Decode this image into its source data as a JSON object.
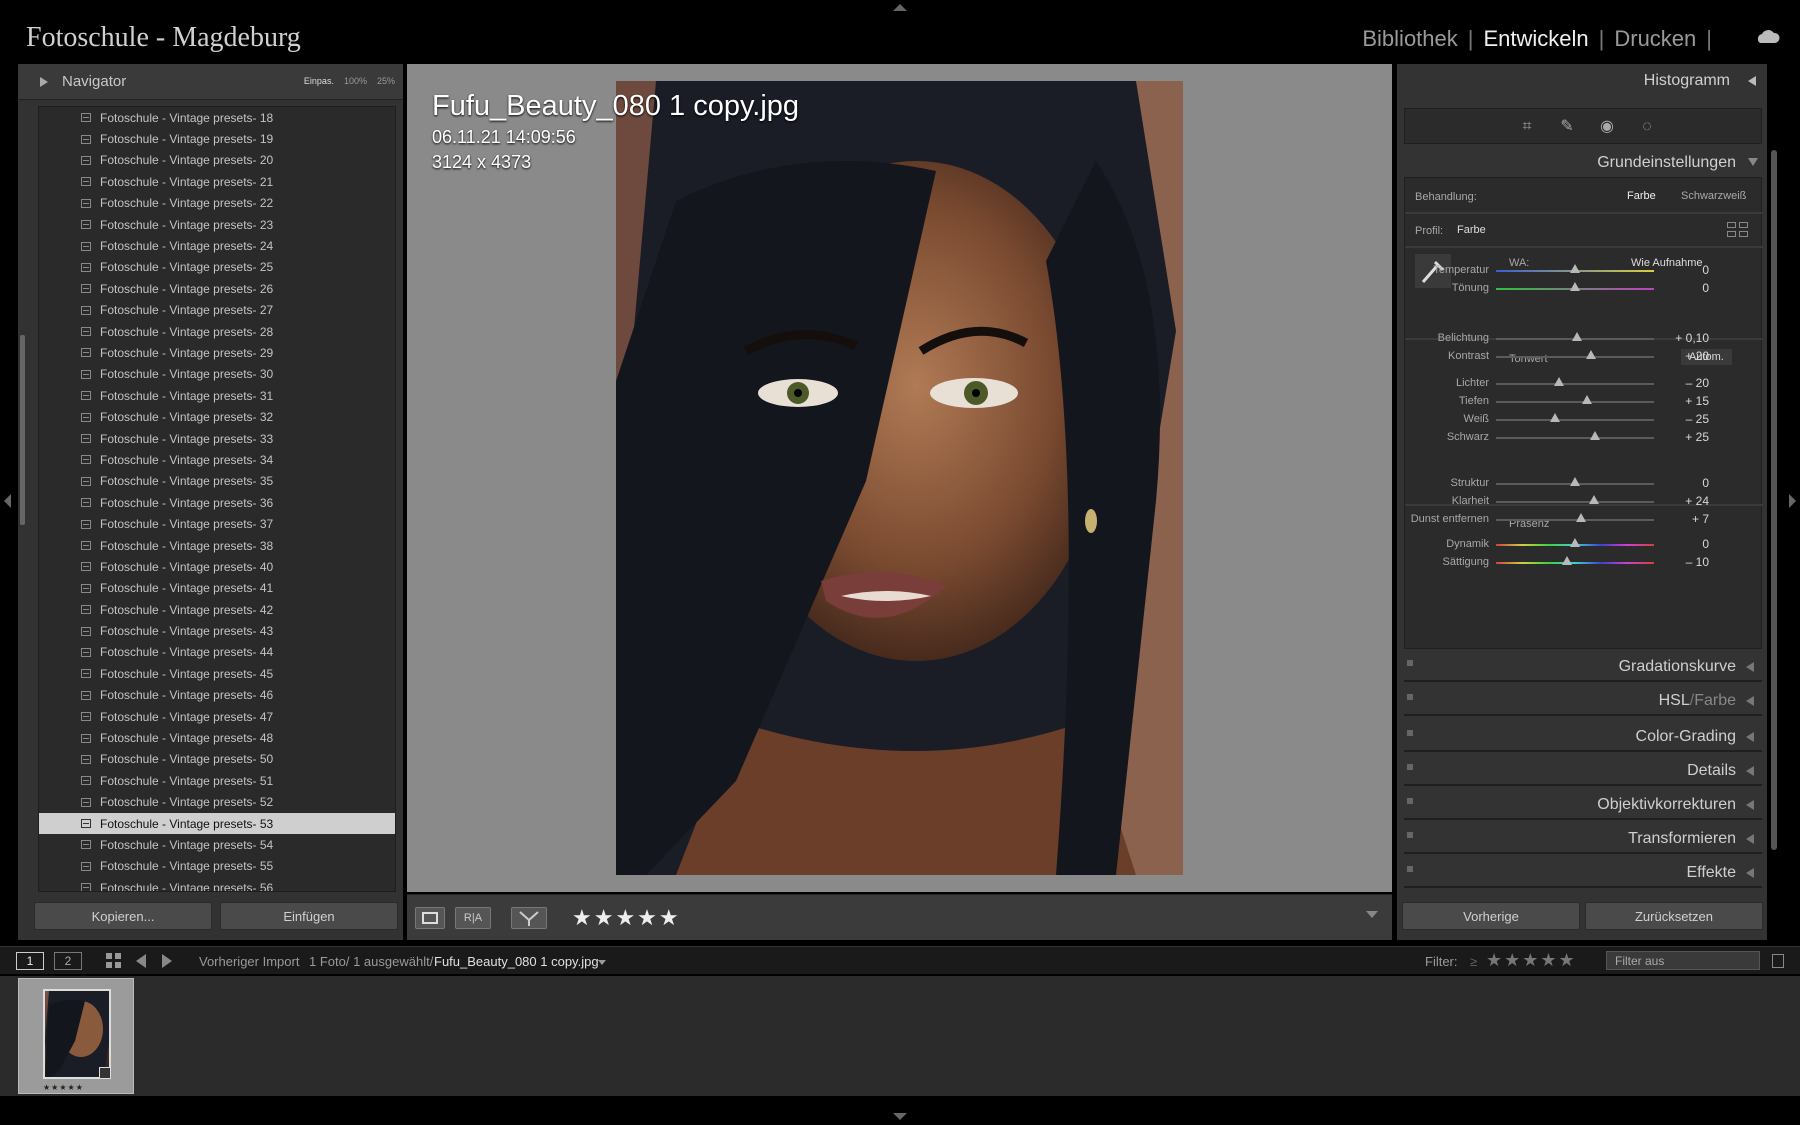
{
  "app": {
    "title": "Fotoschule - Magdeburg",
    "modules": [
      "Bibliothek",
      "Entwickeln",
      "Drucken"
    ],
    "active_module": "Entwickeln",
    "separator": "|"
  },
  "navigator": {
    "title": "Navigator",
    "zoom_options": [
      "Einpas.",
      "100%",
      "25%"
    ]
  },
  "presets": [
    "Fotoschule - Vintage presets- 18",
    "Fotoschule - Vintage presets- 19",
    "Fotoschule - Vintage presets- 20",
    "Fotoschule - Vintage presets- 21",
    "Fotoschule - Vintage presets- 22",
    "Fotoschule - Vintage presets- 23",
    "Fotoschule - Vintage presets- 24",
    "Fotoschule - Vintage presets- 25",
    "Fotoschule - Vintage presets- 26",
    "Fotoschule - Vintage presets- 27",
    "Fotoschule - Vintage presets- 28",
    "Fotoschule - Vintage presets- 29",
    "Fotoschule - Vintage presets- 30",
    "Fotoschule - Vintage presets- 31",
    "Fotoschule - Vintage presets- 32",
    "Fotoschule - Vintage presets- 33",
    "Fotoschule - Vintage presets- 34",
    "Fotoschule - Vintage presets- 35",
    "Fotoschule - Vintage presets- 36",
    "Fotoschule - Vintage presets- 37",
    "Fotoschule - Vintage presets- 38",
    "Fotoschule - Vintage presets- 40",
    "Fotoschule - Vintage presets- 41",
    "Fotoschule - Vintage presets- 42",
    "Fotoschule - Vintage presets- 43",
    "Fotoschule - Vintage presets- 44",
    "Fotoschule - Vintage presets- 45",
    "Fotoschule - Vintage presets- 46",
    "Fotoschule - Vintage presets- 47",
    "Fotoschule - Vintage presets- 48",
    "Fotoschule - Vintage presets- 50",
    "Fotoschule - Vintage presets- 51",
    "Fotoschule - Vintage presets- 52",
    "Fotoschule - Vintage presets- 53",
    "Fotoschule - Vintage presets- 54",
    "Fotoschule - Vintage presets- 55",
    "Fotoschule - Vintage presets- 56"
  ],
  "selected_preset": "Fotoschule - Vintage presets- 53",
  "left_buttons": {
    "copy": "Kopieren...",
    "paste": "Einfügen"
  },
  "photo_info": {
    "filename": "Fufu_Beauty_080 1 copy.jpg",
    "datetime": "06.11.21 14:09:56",
    "dimensions": "3124 x 4373"
  },
  "toolbar": {
    "rating": "★★★★★",
    "ra_label": "R|A"
  },
  "right_panel": {
    "histogram": "Histogramm",
    "basic": "Grundeinstellungen",
    "treatment_label": "Behandlung:",
    "treatment_color": "Farbe",
    "treatment_bw": "Schwarzweiß",
    "profile_label": "Profil:",
    "profile_value": "Farbe",
    "wb_label": "WA:",
    "wb_value": "Wie Aufnahme",
    "tone_label": "Tonwert",
    "auto_label": "Autom.",
    "presence_label": "Präsenz",
    "sliders": [
      {
        "name": "Temperatur",
        "value": "0",
        "pos": 0.5
      },
      {
        "name": "Tönung",
        "value": "0",
        "pos": 0.5
      },
      {
        "name": "Belichtung",
        "value": "+ 0,10",
        "pos": 0.51
      },
      {
        "name": "Kontrast",
        "value": "+ 20",
        "pos": 0.6
      },
      {
        "name": "Lichter",
        "value": "– 20",
        "pos": 0.4
      },
      {
        "name": "Tiefen",
        "value": "+ 15",
        "pos": 0.575
      },
      {
        "name": "Weiß",
        "value": "– 25",
        "pos": 0.375
      },
      {
        "name": "Schwarz",
        "value": "+ 25",
        "pos": 0.625
      },
      {
        "name": "Struktur",
        "value": "0",
        "pos": 0.5
      },
      {
        "name": "Klarheit",
        "value": "+ 24",
        "pos": 0.62
      },
      {
        "name": "Dunst entfernen",
        "value": "+ 7",
        "pos": 0.535
      },
      {
        "name": "Dynamik",
        "value": "0",
        "pos": 0.5
      },
      {
        "name": "Sättigung",
        "value": "– 10",
        "pos": 0.45
      }
    ],
    "sections": [
      "Gradationskurve",
      "HSL",
      "Farbe",
      "Color-Grading",
      "Details",
      "Objektivkorrekturen",
      "Transformieren",
      "Effekte"
    ],
    "hsl_sep": "/",
    "prev_button": "Vorherige",
    "reset_button": "Zurücksetzen"
  },
  "filmbar": {
    "view1": "1",
    "view2": "2",
    "source": "Vorheriger Import",
    "count": "1 Foto/ 1 ausgewählt/",
    "current_file": "Fufu_Beauty_080 1 copy.jpg",
    "filter_label": "Filter:",
    "filter_value": "Filter aus",
    "filter_ge": "≥",
    "filter_stars": "★★★★★"
  },
  "thumbnail": {
    "stars": "★★★★★"
  }
}
